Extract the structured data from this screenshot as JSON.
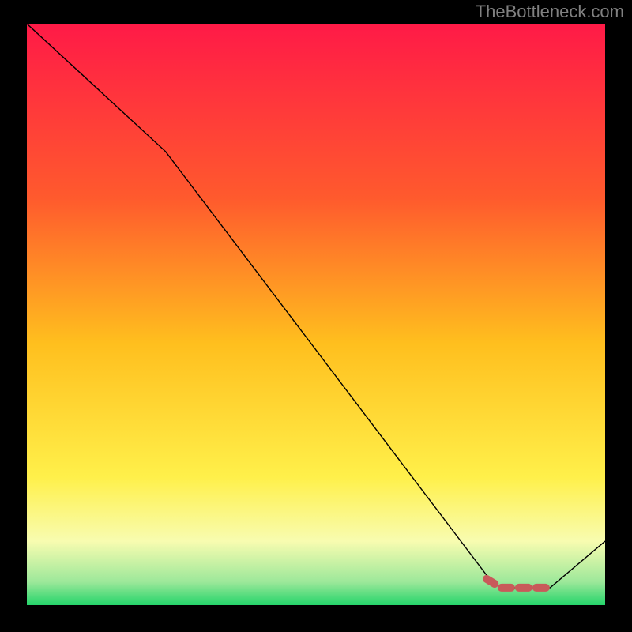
{
  "attribution": "TheBottleneck.com",
  "chart_data": {
    "type": "line",
    "title": "",
    "xlabel": "",
    "ylabel": "",
    "xlim": [
      0,
      100
    ],
    "ylim": [
      0,
      100
    ],
    "background_gradient": {
      "stops": [
        {
          "offset": 0.0,
          "color": "#ff1a47"
        },
        {
          "offset": 0.3,
          "color": "#ff5a2d"
        },
        {
          "offset": 0.55,
          "color": "#ffbf1e"
        },
        {
          "offset": 0.78,
          "color": "#fff04a"
        },
        {
          "offset": 0.89,
          "color": "#f8fcb0"
        },
        {
          "offset": 0.96,
          "color": "#9de89a"
        },
        {
          "offset": 1.0,
          "color": "#24d46a"
        }
      ]
    },
    "series": [
      {
        "name": "bottleneck-curve",
        "color": "#000000",
        "width": 1.4,
        "points": [
          {
            "x": 0.0,
            "y": 100.0
          },
          {
            "x": 24.0,
            "y": 78.0
          },
          {
            "x": 80.0,
            "y": 4.5
          },
          {
            "x": 82.0,
            "y": 3.0
          },
          {
            "x": 90.5,
            "y": 3.0
          },
          {
            "x": 100.0,
            "y": 11.0
          }
        ]
      },
      {
        "name": "optimal-marker",
        "color": "#c85a5a",
        "width": 10,
        "dash": "12 10",
        "linecap": "round",
        "points": [
          {
            "x": 79.5,
            "y": 4.5
          },
          {
            "x": 82.0,
            "y": 3.0
          },
          {
            "x": 91.0,
            "y": 3.0
          }
        ]
      }
    ]
  }
}
